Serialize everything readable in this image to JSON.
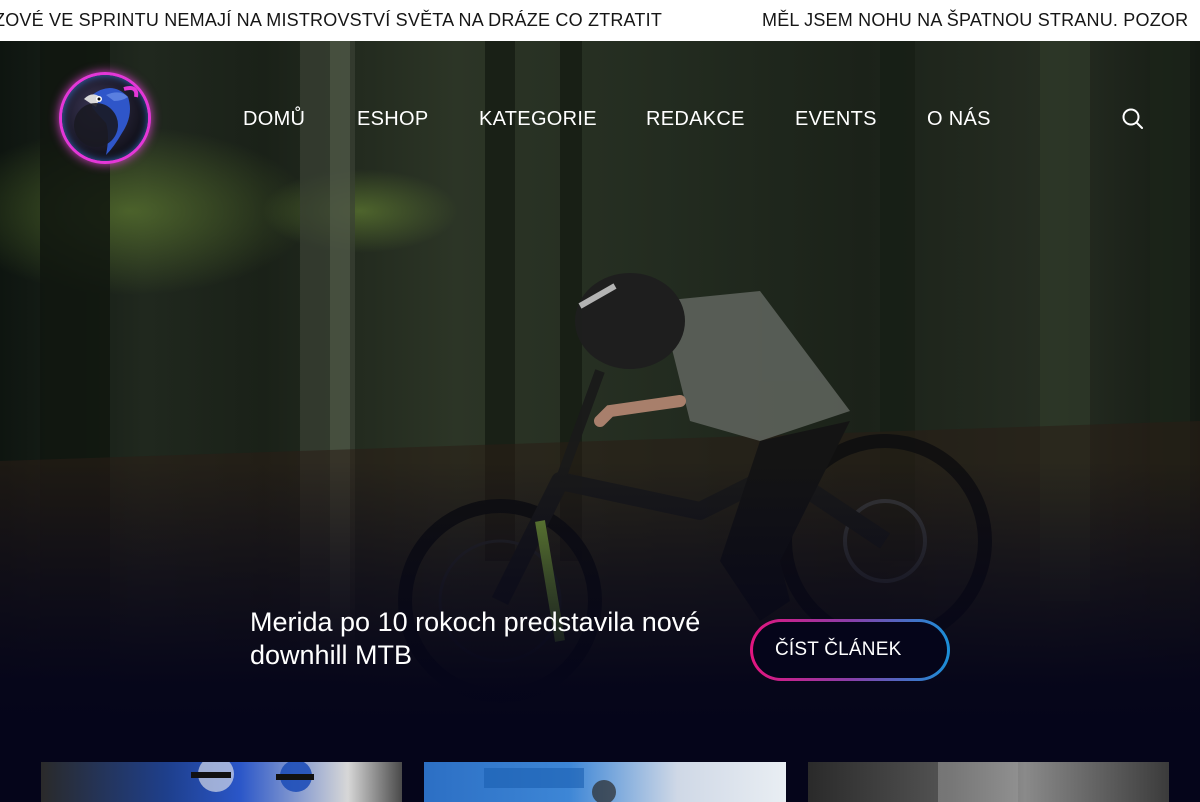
{
  "ticker": {
    "items": [
      "ZOVÉ VE SPRINTU NEMAJÍ NA MISTROVSTVÍ SVĚTA NA DRÁZE CO ZTRATIT",
      "MĚL JSEM NOHU NA ŠPATNOU STRANU. POZOR"
    ]
  },
  "nav": {
    "items": [
      "DOMŮ",
      "ESHOP",
      "KATEGORIE",
      "REDAKCE",
      "EVENTS",
      "O NÁS"
    ]
  },
  "hero": {
    "headline": "Merida po 10 rokoch predstavila nové downhill MTB",
    "cta_label": "ČÍST ČLÁNEK"
  },
  "colors": {
    "background": "#05051a",
    "accent_pink": "#e3157f",
    "accent_blue": "#1a8fd8",
    "logo_glow": "#e437d8"
  },
  "icons": {
    "search": "search-icon",
    "logo": "parrot-logo"
  }
}
